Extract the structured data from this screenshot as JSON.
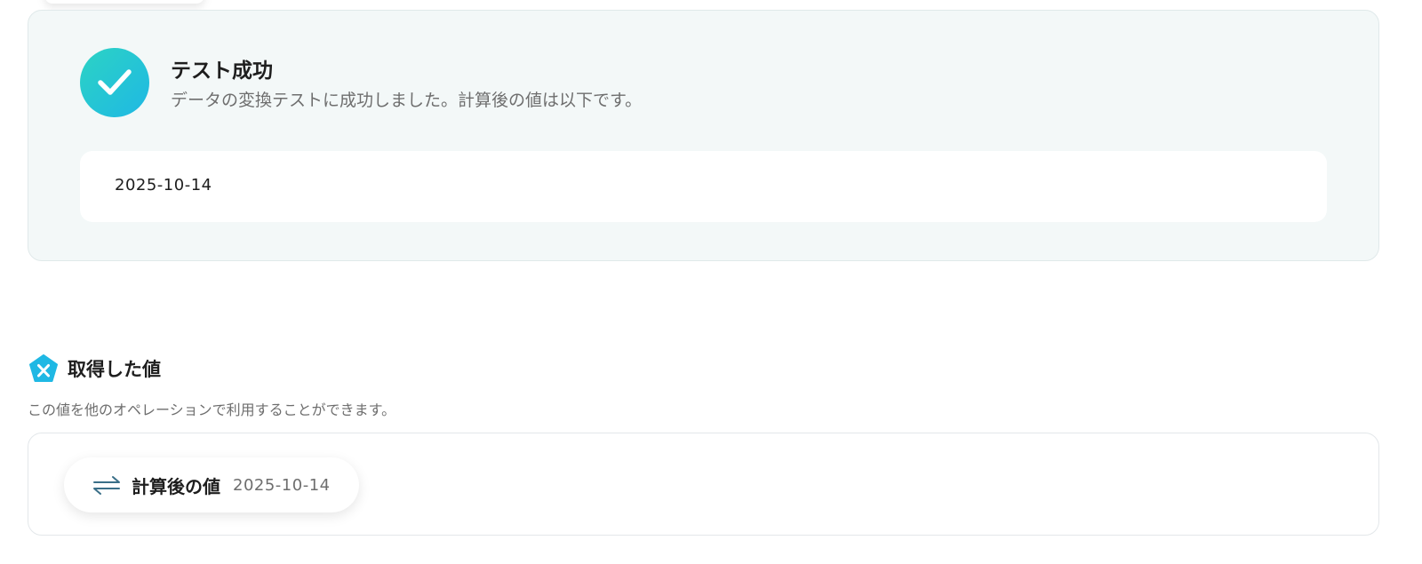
{
  "success": {
    "icon": "check-icon",
    "title": "テスト成功",
    "description": "データの変換テストに成功しました。計算後の値は以下です。",
    "result_value": "2025-10-14"
  },
  "obtained_values": {
    "icon": "variable-x-icon",
    "title": "取得した値",
    "description": "この値を他のオペレーションで利用することができます。",
    "items": [
      {
        "icon": "convert-arrows-icon",
        "label": "計算後の値",
        "value": "2025-10-14"
      }
    ]
  },
  "colors": {
    "accent_gradient_start": "#2cd3c4",
    "accent_gradient_end": "#1fb8e4",
    "variable_icon": "#1fb8e4",
    "panel_background": "#f3f8f8"
  }
}
